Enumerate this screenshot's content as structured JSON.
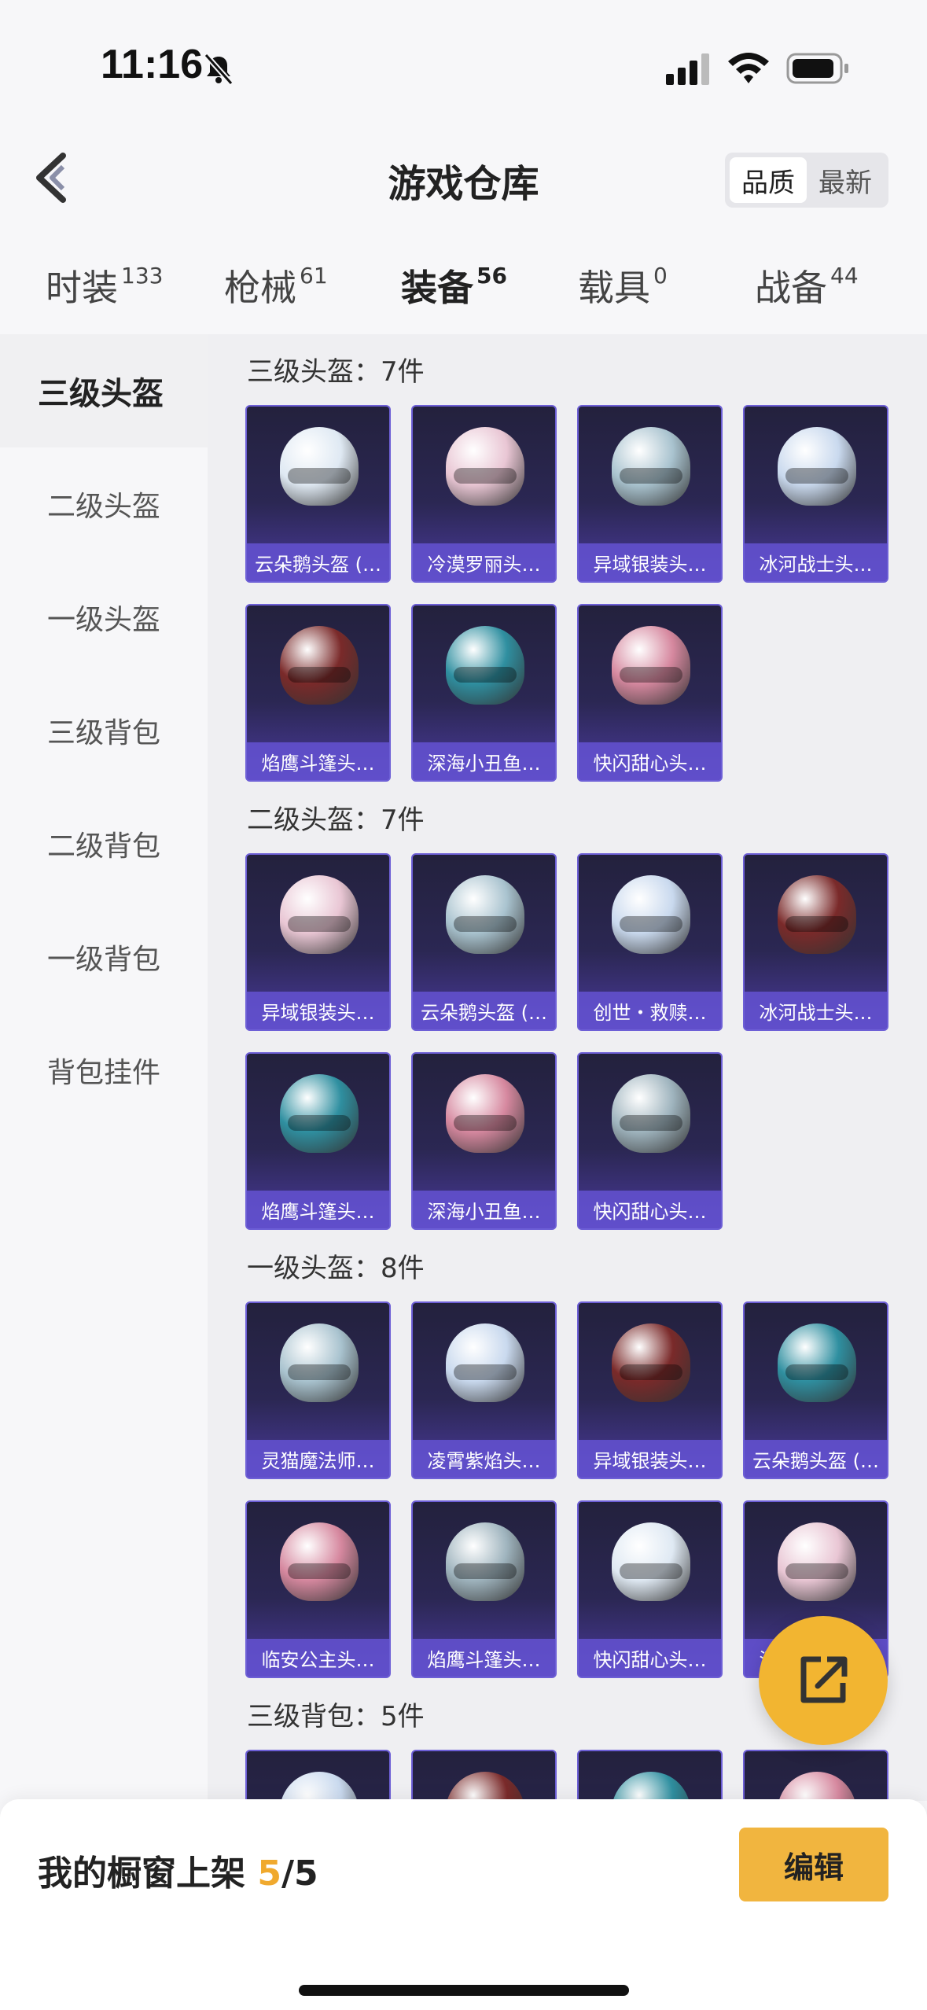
{
  "status_bar": {
    "time": "11:16"
  },
  "header": {
    "title": "游戏仓库",
    "sort_options": [
      "品质",
      "最新"
    ]
  },
  "tabs": [
    {
      "label": "时装",
      "count": "133"
    },
    {
      "label": "枪械",
      "count": "61"
    },
    {
      "label": "装备",
      "count": "56"
    },
    {
      "label": "载具",
      "count": "0"
    },
    {
      "label": "战备",
      "count": "44"
    }
  ],
  "sidebar": {
    "items": [
      "三级头盔",
      "二级头盔",
      "一级头盔",
      "三级背包",
      "二级背包",
      "一级背包",
      "背包挂件"
    ]
  },
  "sections": [
    {
      "title": "三级头盔：7件",
      "items": [
        "云朵鹅头盔 (…",
        "冷漠罗丽头…",
        "异域银装头…",
        "冰河战士头…",
        "焰鹰斗篷头…",
        "深海小丑鱼…",
        "快闪甜心头…"
      ]
    },
    {
      "title": "二级头盔：7件",
      "items": [
        "异域银装头…",
        "云朵鹅头盔 (…",
        "创世・救赎…",
        "冰河战士头…",
        "焰鹰斗篷头…",
        "深海小丑鱼…",
        "快闪甜心头…"
      ]
    },
    {
      "title": "一级头盔：8件",
      "items": [
        "灵猫魔法师…",
        "凌霄紫焰头…",
        "异域银装头…",
        "云朵鹅头盔 (…",
        "临安公主头…",
        "焰鹰斗篷头…",
        "快闪甜心头…",
        "深海小丑鱼…"
      ]
    },
    {
      "title": "三级背包：5件",
      "items": []
    }
  ],
  "colors": {
    "accent": "#f0a92e",
    "card_border": "#6d5fd6"
  },
  "bottom_bar": {
    "label": "我的橱窗上架",
    "current": "5",
    "total": "/5",
    "edit_label": "编辑"
  }
}
